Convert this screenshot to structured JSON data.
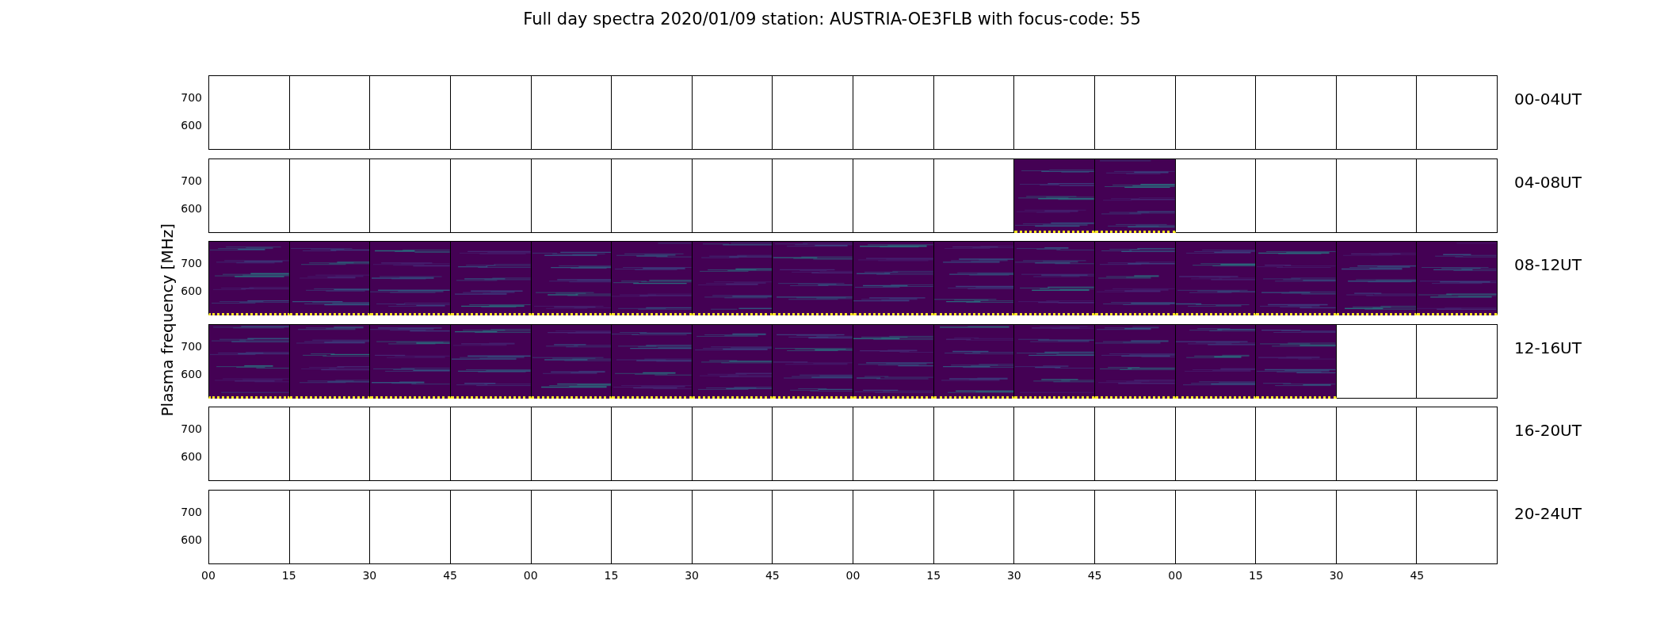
{
  "title": "Full day spectra 2020/01/09 station: AUSTRIA-OE3FLB with focus-code: 55",
  "y_axis_label": "Plasma frequency [MHz]",
  "rows": [
    {
      "label": "00-04UT",
      "y_tick_labels": [
        "700",
        "600"
      ],
      "panels": [
        {
          "has_data": false
        },
        {
          "has_data": false
        },
        {
          "has_data": false
        },
        {
          "has_data": false
        },
        {
          "has_data": false
        },
        {
          "has_data": false
        },
        {
          "has_data": false
        },
        {
          "has_data": false
        },
        {
          "has_data": false
        },
        {
          "has_data": false
        },
        {
          "has_data": false
        },
        {
          "has_data": false
        },
        {
          "has_data": false
        },
        {
          "has_data": false
        },
        {
          "has_data": false
        },
        {
          "has_data": false
        }
      ]
    },
    {
      "label": "04-08UT",
      "y_tick_labels": [
        "700",
        "600"
      ],
      "panels": [
        {
          "has_data": false
        },
        {
          "has_data": false
        },
        {
          "has_data": false
        },
        {
          "has_data": false
        },
        {
          "has_data": false
        },
        {
          "has_data": false
        },
        {
          "has_data": false
        },
        {
          "has_data": false
        },
        {
          "has_data": false
        },
        {
          "has_data": false
        },
        {
          "has_data": true
        },
        {
          "has_data": true
        },
        {
          "has_data": false
        },
        {
          "has_data": false
        },
        {
          "has_data": false
        },
        {
          "has_data": false
        }
      ]
    },
    {
      "label": "08-12UT",
      "y_tick_labels": [
        "700",
        "600"
      ],
      "panels": [
        {
          "has_data": true
        },
        {
          "has_data": true
        },
        {
          "has_data": true
        },
        {
          "has_data": true
        },
        {
          "has_data": true
        },
        {
          "has_data": true
        },
        {
          "has_data": true
        },
        {
          "has_data": true
        },
        {
          "has_data": true
        },
        {
          "has_data": true
        },
        {
          "has_data": true
        },
        {
          "has_data": true
        },
        {
          "has_data": true
        },
        {
          "has_data": true
        },
        {
          "has_data": true
        },
        {
          "has_data": true
        }
      ]
    },
    {
      "label": "12-16UT",
      "y_tick_labels": [
        "700",
        "600"
      ],
      "panels": [
        {
          "has_data": true
        },
        {
          "has_data": true
        },
        {
          "has_data": true
        },
        {
          "has_data": true
        },
        {
          "has_data": true
        },
        {
          "has_data": true
        },
        {
          "has_data": true
        },
        {
          "has_data": true
        },
        {
          "has_data": true
        },
        {
          "has_data": true
        },
        {
          "has_data": true
        },
        {
          "has_data": true
        },
        {
          "has_data": true
        },
        {
          "has_data": true
        },
        {
          "has_data": false
        },
        {
          "has_data": false
        }
      ]
    },
    {
      "label": "16-20UT",
      "y_tick_labels": [
        "700",
        "600"
      ],
      "panels": [
        {
          "has_data": false
        },
        {
          "has_data": false
        },
        {
          "has_data": false
        },
        {
          "has_data": false
        },
        {
          "has_data": false
        },
        {
          "has_data": false
        },
        {
          "has_data": false
        },
        {
          "has_data": false
        },
        {
          "has_data": false
        },
        {
          "has_data": false
        },
        {
          "has_data": false
        },
        {
          "has_data": false
        },
        {
          "has_data": false
        },
        {
          "has_data": false
        },
        {
          "has_data": false
        },
        {
          "has_data": false
        }
      ]
    },
    {
      "label": "20-24UT",
      "y_tick_labels": [
        "700",
        "600"
      ],
      "panels": [
        {
          "has_data": false
        },
        {
          "has_data": false
        },
        {
          "has_data": false
        },
        {
          "has_data": false
        },
        {
          "has_data": false
        },
        {
          "has_data": false
        },
        {
          "has_data": false
        },
        {
          "has_data": false
        },
        {
          "has_data": false
        },
        {
          "has_data": false
        },
        {
          "has_data": false
        },
        {
          "has_data": false
        },
        {
          "has_data": false
        },
        {
          "has_data": false
        },
        {
          "has_data": false
        },
        {
          "has_data": false
        }
      ]
    }
  ],
  "x_tick_labels": [
    "00",
    "15",
    "30",
    "45",
    "00",
    "15",
    "30",
    "45",
    "00",
    "15",
    "30",
    "45",
    "00",
    "15",
    "30",
    "45"
  ]
}
